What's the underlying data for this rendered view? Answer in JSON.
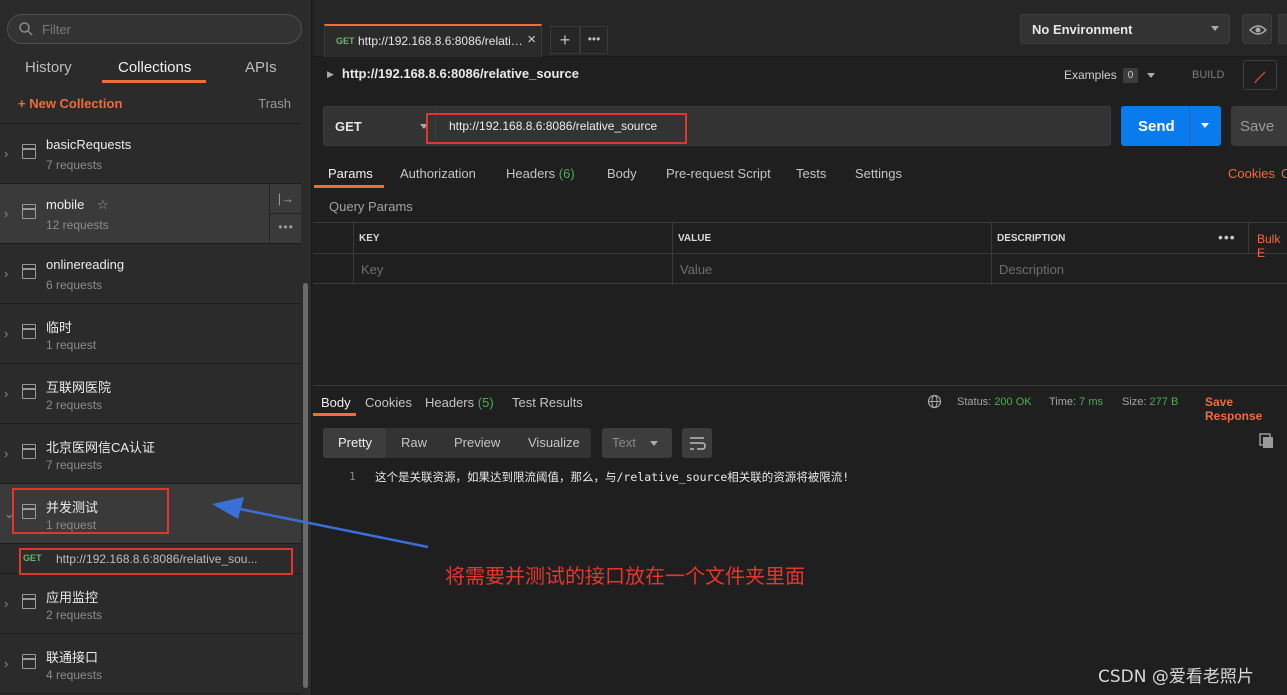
{
  "sidebar": {
    "filter_placeholder": "Filter",
    "tabs": [
      {
        "label": "History"
      },
      {
        "label": "Collections"
      },
      {
        "label": "APIs"
      }
    ],
    "active_tab": "Collections",
    "new_collection": "+ New Collection",
    "trash": "Trash",
    "collections": [
      {
        "name": "basicRequests",
        "count": "7 requests"
      },
      {
        "name": "mobile",
        "count": "12 requests"
      },
      {
        "name": "onlinereading",
        "count": "6 requests"
      },
      {
        "name": "临时",
        "count": "1 request"
      },
      {
        "name": "互联网医院",
        "count": "2 requests"
      },
      {
        "name": "北京医网信CA认证",
        "count": "7 requests"
      },
      {
        "name": "并发测试",
        "count": "1 request"
      },
      {
        "name": "应用监控",
        "count": "2 requests"
      },
      {
        "name": "联通接口",
        "count": "4 requests"
      }
    ],
    "expanded_request": {
      "method": "GET",
      "url": "http://192.168.8.6:8086/relative_sou..."
    }
  },
  "top": {
    "tab_method": "GET",
    "tab_url": "http://192.168.8.6:8086/relativ...",
    "environment": "No Environment"
  },
  "request": {
    "title": "http://192.168.8.6:8086/relative_source",
    "examples_label": "Examples",
    "examples_count": "0",
    "build_label": "BUILD",
    "method": "GET",
    "url": "http://192.168.8.6:8086/relative_source",
    "send_label": "Send",
    "save_label": "Save",
    "tabs": {
      "params": "Params",
      "authorization": "Authorization",
      "headers": "Headers",
      "headers_count": "(6)",
      "body": "Body",
      "prerequest": "Pre-request Script",
      "tests": "Tests",
      "settings": "Settings"
    },
    "cookies_label": "Cookies",
    "cookies_cut": "C",
    "query_params_label": "Query Params",
    "table": {
      "headers": [
        "KEY",
        "VALUE",
        "DESCRIPTION"
      ],
      "placeholders": [
        "Key",
        "Value",
        "Description"
      ],
      "more": "•••",
      "bulk_edit": "Bulk E"
    }
  },
  "response": {
    "tabs": {
      "body": "Body",
      "cookies": "Cookies",
      "headers": "Headers",
      "headers_count": "(5)",
      "test_results": "Test Results"
    },
    "status_label": "Status:",
    "status_value": "200 OK",
    "time_label": "Time:",
    "time_value": "7 ms",
    "size_label": "Size:",
    "size_value": "277 B",
    "save_response": "Save Response",
    "formats": [
      "Pretty",
      "Raw",
      "Preview",
      "Visualize"
    ],
    "active_format": "Pretty",
    "language": "Text",
    "line_number": "1",
    "body_text": "这个是关联资源，如果达到限流阈值，那么，与/relative_source相关联的资源将被限流!"
  },
  "annotation_text": "将需要并测试的接口放在一个文件夹里面",
  "watermark": "CSDN @爱看老照片",
  "colors": {
    "accent": "#f26b3a",
    "send": "#097bed",
    "get_method": "#6cb26c",
    "status_ok": "#4caf50",
    "annotation_red": "#e3342f",
    "arrow_blue": "#3a6fd8"
  }
}
